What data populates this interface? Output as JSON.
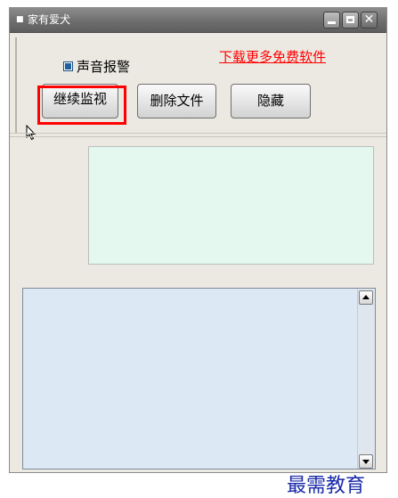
{
  "window": {
    "title": "家有爱犬",
    "title_icon": "app-icon"
  },
  "controls": {
    "sound_alarm_label": "声音报警",
    "sound_alarm_checked": true,
    "download_link": "下载更多免费软件"
  },
  "buttons": {
    "continue_monitor": "继续监视",
    "delete_files": "删除文件",
    "hide": "隐藏"
  },
  "watermark": "最需教育",
  "colors": {
    "titlebar": "#6e6e6e",
    "link": "#ff0000",
    "highlight": "#ff0000",
    "monitor_bg": "#e4f8ef",
    "log_bg": "#dce8f4"
  },
  "icons": [
    "minimize-icon",
    "maximize-icon",
    "close-icon",
    "scroll-up-icon",
    "scroll-down-icon",
    "cursor-icon"
  ]
}
